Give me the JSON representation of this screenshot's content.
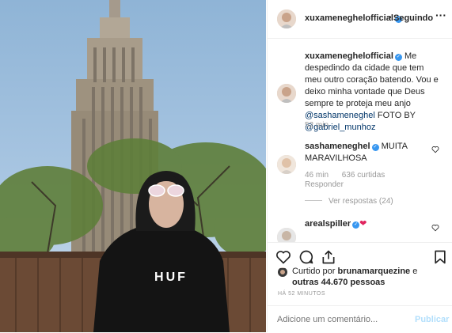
{
  "header": {
    "username": "xuxameneghelofficial",
    "verified_icon": "verified-badge-icon",
    "separator": "•",
    "follow_label": "Seguindo",
    "more_icon": "more-options-icon"
  },
  "caption": {
    "username": "xuxameneghelofficial",
    "text_1": "Me despedindo da cidade que tem meu outro coração batendo. Vou e deixo minha vontade que Deus sempre te proteja meu anjo",
    "mention_1": "@sashameneghel",
    "text_2": "FOTO BY",
    "mention_2": "@gabriel_munhoz",
    "age": "52 min"
  },
  "comments": [
    {
      "username": "sashameneghel",
      "text": "MUITA MARAVILHOSA",
      "age": "46 min",
      "likes": "636 curtidas",
      "reply_label": "Responder",
      "view_replies": "Ver respostas (24)"
    },
    {
      "username": "arealspiller",
      "text": "❤"
    }
  ],
  "actions": {
    "like_icon": "heart-icon",
    "comment_icon": "comment-icon",
    "share_icon": "share-icon",
    "save_icon": "bookmark-icon"
  },
  "likes": {
    "prefix": "Curtido por",
    "user": "brunamarquezine",
    "middle": "e",
    "others": "outras 44.670 pessoas"
  },
  "timestamp": "HÁ 52 MINUTOS",
  "add_comment": {
    "placeholder": "Adicione um comentário...",
    "publish_label": "Publicar"
  },
  "photo": {
    "shirt_text": "HUF"
  },
  "colors": {
    "link": "#003569",
    "verified": "#3897f0",
    "muted": "#999999",
    "publish_disabled": "#b2dffc"
  }
}
